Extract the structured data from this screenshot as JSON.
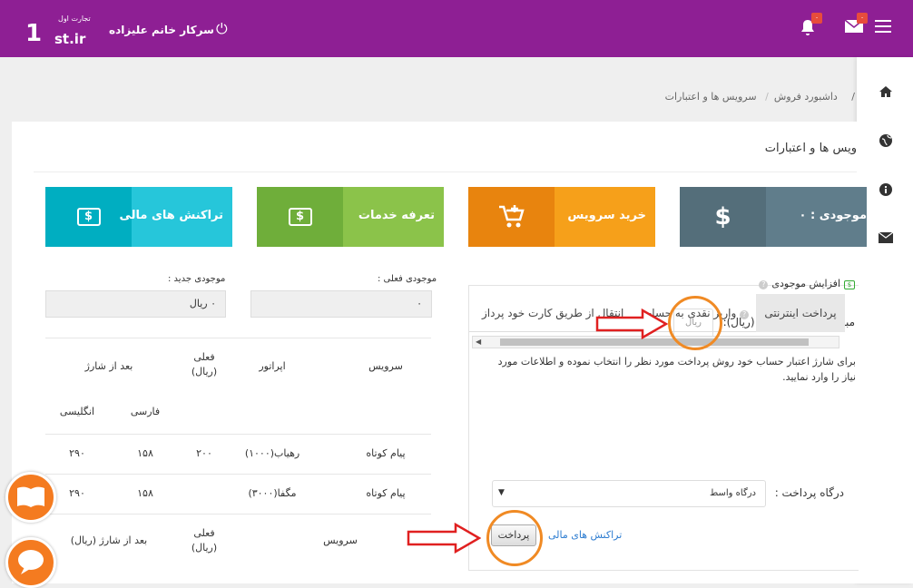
{
  "header": {
    "logo": {
      "number": "1",
      "domain": "st.ir",
      "tagline": "تجارت اول"
    },
    "username": "سرکار خانم علیزاده",
    "notification_badge": "۰",
    "mail_badge": "۰",
    "icons": [
      "power-icon",
      "bell-icon",
      "mail-icon",
      "menu-icon"
    ]
  },
  "rightbar": {
    "icons": [
      "home-icon",
      "globe-icon",
      "info-icon",
      "mail-icon"
    ]
  },
  "breadcrumb": [
    "/",
    "داشبورد فروش",
    "سرویس ها و اعتبارات"
  ],
  "panel": {
    "title": "ویس ها و اعتبارات",
    "tiles": [
      {
        "label": "موجودی : ۰",
        "icon": "$",
        "color": "#607d8b",
        "dark": "#546e7a"
      },
      {
        "label": "خرید سرویس",
        "icon": "cart-plus-icon",
        "color": "#f6a01a",
        "dark": "#e8840e"
      },
      {
        "label": "تعرفه خدمات",
        "icon": "money-icon",
        "color": "#8bc34a",
        "dark": "#6fae3a"
      },
      {
        "label": "تراکنش های مالی",
        "icon": "money-icon",
        "color": "#26c6da",
        "dark": "#00aec1"
      }
    ],
    "current_balance_label": "موجودی فعلی :",
    "current_balance_value": "۰",
    "new_balance_label": "موجودی جدید :",
    "new_balance_value": "۰ ریال"
  },
  "table": {
    "headers": {
      "service": "سرویس",
      "operator": "اپراتور",
      "current": "فعلی",
      "current_unit": "(ریال)",
      "after": "بعد از شارژ",
      "persian": "فارسی",
      "english": "انگلیسی"
    },
    "rows": [
      {
        "service": "پیام کوتاه",
        "operator": "رهیاب(۱۰۰۰)",
        "current": "۲۰۰",
        "fa": "۱۵۸",
        "en": "۲۹۰"
      },
      {
        "service": "پیام کوتاه",
        "operator": "مگفا(۳۰۰۰)",
        "current": "",
        "fa": "۱۵۸",
        "en": "۲۹۰"
      }
    ],
    "footer": {
      "service": "سرویس",
      "current": "فعلی",
      "current_unit": "(ریال)",
      "after": "بعد از شارژ (ریال)"
    }
  },
  "increase": {
    "heading": "افزایش موجودی",
    "amount_label": "مبلغ افزایش موجودی (ریال):",
    "amount_placeholder": "ریال",
    "description": "برای شارژ اعتبار حساب خود روش پرداخت مورد نظر را انتخاب نموده و اطلاعات مورد نیاز را وارد نمایید.",
    "tabs": [
      "پرداخت اینترنتی",
      "واریز نقدی به حساب",
      "انتقال از طریق کارت خود پرداز"
    ],
    "gateway_label": "درگاه پرداخت :",
    "gateway_value": "درگاه واسط",
    "pay_button": "پرداخت",
    "transactions_link": "تراکنش های مالی"
  }
}
